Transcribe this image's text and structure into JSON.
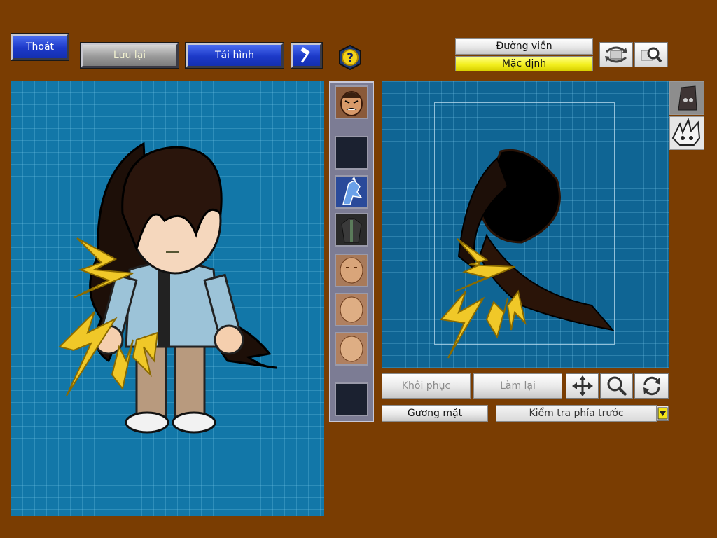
{
  "toolbar": {
    "exit_label": "Thoát",
    "save_label": "Lưu lại",
    "reload_label": "Tải hình",
    "tool_icon": "hammer-icon",
    "help_icon": "question-icon"
  },
  "view_options": {
    "outline_label": "Đường viền",
    "default_label": "Mặc định",
    "rotate_icon": "rotate-view-icon",
    "zoom_icon": "zoom-view-icon"
  },
  "thumbnails": [
    {
      "name": "face-angry"
    },
    {
      "name": "empty"
    },
    {
      "name": "blue-dragon"
    },
    {
      "name": "dark-outfit"
    },
    {
      "name": "face-plain"
    },
    {
      "name": "face-plain-2"
    },
    {
      "name": "face-plain-3"
    },
    {
      "name": "empty-2"
    }
  ],
  "side_icons": [
    "skull-stone-icon",
    "spiky-hair-icon"
  ],
  "editor": {
    "restore_label": "Khôi phục",
    "redo_label": "Làm lại",
    "move_icon": "move-icon",
    "zoom_icon": "magnifier-icon",
    "rotate_icon": "rotate-icon",
    "part_label": "Gương mặt",
    "view_label": "Kiểm tra phía trước"
  },
  "colors": {
    "background": "#7a3d02",
    "panel_blue": "#1277a8",
    "button_blue": "#1c39c8",
    "highlight_yellow": "#f4f020"
  }
}
